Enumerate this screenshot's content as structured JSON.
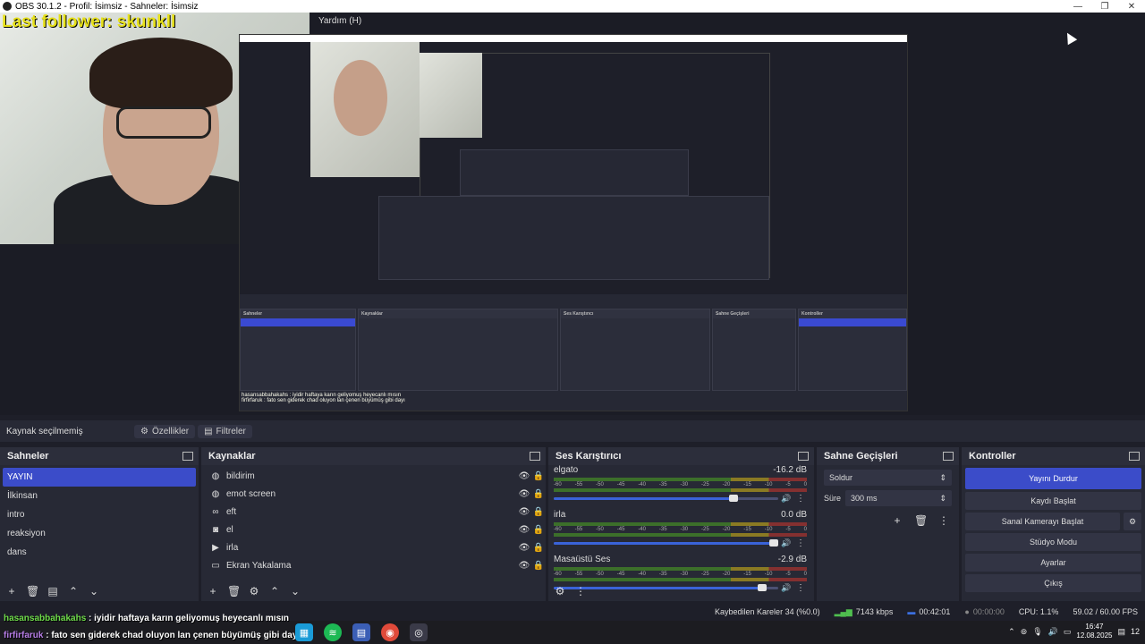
{
  "window": {
    "title": "OBS 30.1.2 - Profil: İsimsiz - Sahneler: İsimsiz",
    "minimize": "—",
    "maximize": "❐",
    "close": "✕"
  },
  "preview": {
    "overlay_text": "Last follower: skunkll",
    "menu_label": "Yardım (H)",
    "nested_chat_line1": "hasansabbahakahs : iyidir haftaya karın geliyomuş heyecanlı mısın",
    "nested_chat_line2": "firfirfaruk : fato sen giderek chad oluyon lan çenen büyümüş gibi dayı"
  },
  "props_bar": {
    "no_source": "Kaynak seçilmemiş",
    "properties_label": "Özellikler",
    "filters_label": "Filtreler"
  },
  "scenes": {
    "title": "Sahneler",
    "items": [
      "YAYIN",
      "İlkinsan",
      "intro",
      "reaksiyon",
      "dans"
    ]
  },
  "sources": {
    "title": "Kaynaklar",
    "items": [
      {
        "label": "bildirim",
        "icon": "globe-icon"
      },
      {
        "label": "emot screen",
        "icon": "globe-icon"
      },
      {
        "label": "eft",
        "icon": "link-icon"
      },
      {
        "label": "el",
        "icon": "camera-icon"
      },
      {
        "label": "irla",
        "icon": "play-icon"
      },
      {
        "label": "Ekran Yakalama",
        "icon": "monitor-icon"
      }
    ]
  },
  "mixer": {
    "title": "Ses Karıştırıcı",
    "ticks": [
      "-60",
      "-55",
      "-50",
      "-45",
      "-40",
      "-35",
      "-30",
      "-25",
      "-20",
      "-15",
      "-10",
      "-5",
      "0"
    ],
    "channels": [
      {
        "name": "elgato",
        "db": "-16.2 dB",
        "volume": 0.82
      },
      {
        "name": "irla",
        "db": "0.0 dB",
        "volume": 1.0
      },
      {
        "name": "Masaüstü Ses",
        "db": "-2.9 dB",
        "volume": 0.95
      }
    ]
  },
  "transitions": {
    "title": "Sahne Geçişleri",
    "selected": "Soldur",
    "duration_label": "Süre",
    "duration_value": "300 ms"
  },
  "controls": {
    "title": "Kontroller",
    "stop_stream": "Yayını Durdur",
    "start_recording": "Kaydı Başlat",
    "start_virtualcam": "Sanal Kamerayı Başlat",
    "studio_mode": "Stüdyo Modu",
    "settings": "Ayarlar",
    "exit": "Çıkış"
  },
  "status": {
    "dropped_frames": "Kaybedilen Kareler 34 (%0.0)",
    "bitrate": "7143 kbps",
    "stream_time": "00:42:01",
    "record_time": "00:00:00",
    "cpu": "CPU: 1.1%",
    "fps": "59.02 / 60.00 FPS"
  },
  "chat": {
    "line1_user": "hasansabbahakahs",
    "line1_msg": " : iyidir haftaya karın geliyomuş heyecanlı mısın",
    "line2_user": "firfirfaruk",
    "line2_msg": " : fato sen giderek chad oluyon lan çenen büyümüş gibi dayı"
  },
  "taskbar": {
    "time": "16:47",
    "date": "12.08.2025",
    "notification_count": "12"
  }
}
